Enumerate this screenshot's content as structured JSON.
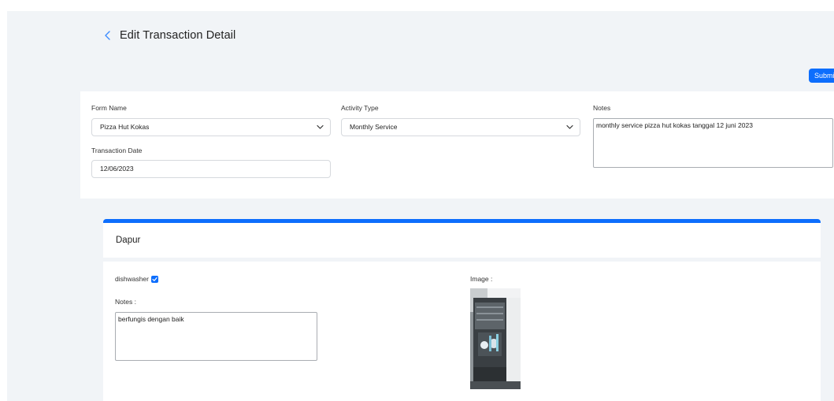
{
  "header": {
    "title": "Edit Transaction Detail"
  },
  "toolbar": {
    "submit_label": "Submit"
  },
  "form": {
    "form_name": {
      "label": "Form Name",
      "value": "Pizza Hut Kokas"
    },
    "activity_type": {
      "label": "Activity Type",
      "value": "Monthly Service"
    },
    "notes": {
      "label": "Notes",
      "value": "monthly service pizza hut kokas tanggal 12 juni 2023"
    },
    "transaction_date": {
      "label": "Transaction Date",
      "value": "12/06/2023"
    }
  },
  "section": {
    "title": "Dapur",
    "item": {
      "name": "dishwasher",
      "checked": true,
      "notes_label": "Notes :",
      "notes_value": "berfungis dengan baik",
      "image_label": "Image :"
    }
  },
  "colors": {
    "accent": "#0d6efd",
    "background": "#f1f4f7"
  },
  "icons": {
    "back": "chevron-left-icon",
    "dropdown": "chevron-down-icon",
    "check": "check-icon"
  }
}
